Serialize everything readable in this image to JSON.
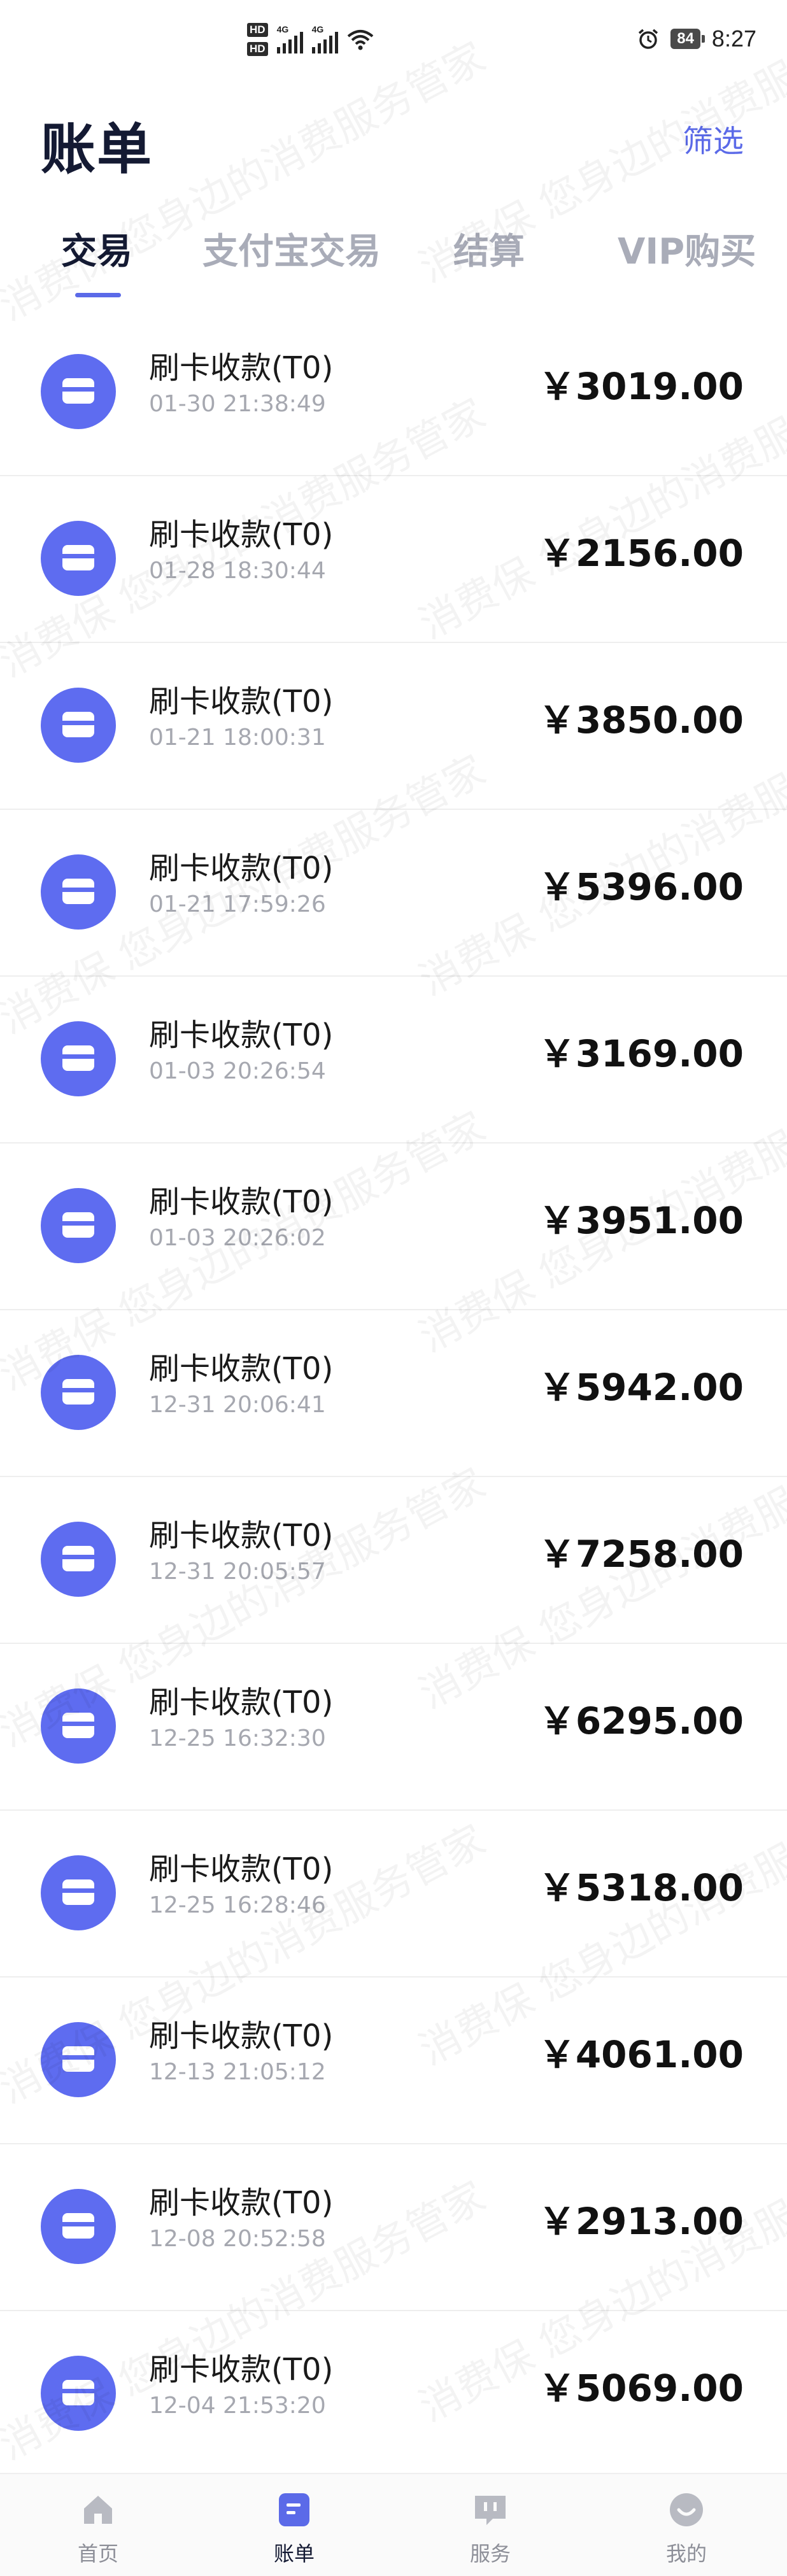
{
  "status_bar": {
    "hd_badges": [
      "HD",
      "HD"
    ],
    "network": [
      "4G",
      "4G"
    ],
    "battery": "84",
    "time": "8:27"
  },
  "header": {
    "title": "账单",
    "filter_label": "筛选"
  },
  "tabs": [
    {
      "label": "交易",
      "active": true
    },
    {
      "label": "支付宝交易",
      "active": false
    },
    {
      "label": "结算",
      "active": false
    },
    {
      "label": "VIP购买",
      "active": false
    }
  ],
  "transactions": [
    {
      "title": "刷卡收款(T0)",
      "time": "01-30 21:38:49",
      "amount": "￥3019.00"
    },
    {
      "title": "刷卡收款(T0)",
      "time": "01-28 18:30:44",
      "amount": "￥2156.00"
    },
    {
      "title": "刷卡收款(T0)",
      "time": "01-21 18:00:31",
      "amount": "￥3850.00"
    },
    {
      "title": "刷卡收款(T0)",
      "time": "01-21 17:59:26",
      "amount": "￥5396.00"
    },
    {
      "title": "刷卡收款(T0)",
      "time": "01-03 20:26:54",
      "amount": "￥3169.00"
    },
    {
      "title": "刷卡收款(T0)",
      "time": "01-03 20:26:02",
      "amount": "￥3951.00"
    },
    {
      "title": "刷卡收款(T0)",
      "time": "12-31 20:06:41",
      "amount": "￥5942.00"
    },
    {
      "title": "刷卡收款(T0)",
      "time": "12-31 20:05:57",
      "amount": "￥7258.00"
    },
    {
      "title": "刷卡收款(T0)",
      "time": "12-25 16:32:30",
      "amount": "￥6295.00"
    },
    {
      "title": "刷卡收款(T0)",
      "time": "12-25 16:28:46",
      "amount": "￥5318.00"
    },
    {
      "title": "刷卡收款(T0)",
      "time": "12-13 21:05:12",
      "amount": "￥4061.00"
    },
    {
      "title": "刷卡收款(T0)",
      "time": "12-08 20:52:58",
      "amount": "￥2913.00"
    },
    {
      "title": "刷卡收款(T0)",
      "time": "12-04 21:53:20",
      "amount": "￥5069.00"
    }
  ],
  "watermark_text": "消费保 您身边的消费服务管家",
  "bottom_nav": [
    {
      "label": "首页",
      "icon": "home-icon",
      "active": false
    },
    {
      "label": "账单",
      "icon": "bill-icon",
      "active": true
    },
    {
      "label": "服务",
      "icon": "service-icon",
      "active": false
    },
    {
      "label": "我的",
      "icon": "profile-icon",
      "active": false
    }
  ],
  "colors": {
    "accent": "#5b6ae8",
    "icon_bg": "#5e6cf0",
    "title_dark": "#141a33",
    "muted": "#a6a8b0"
  }
}
